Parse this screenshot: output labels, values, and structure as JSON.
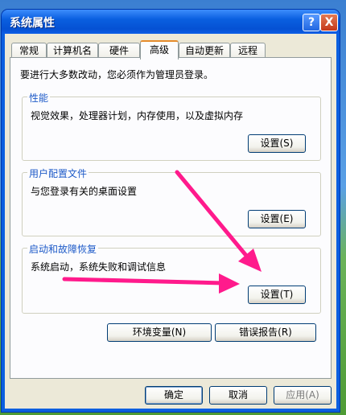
{
  "window": {
    "title": "系统属性",
    "help_label": "?",
    "close_label": "X"
  },
  "tabs": [
    {
      "label": "常规"
    },
    {
      "label": "计算机名"
    },
    {
      "label": "硬件"
    },
    {
      "label": "高级",
      "active": true
    },
    {
      "label": "自动更新"
    },
    {
      "label": "远程"
    }
  ],
  "advanced": {
    "admin_note": "要进行大多数改动，您必须作为管理员登录。",
    "performance": {
      "title": "性能",
      "desc": "视觉效果，处理器计划，内存使用，以及虚拟内存",
      "button": "设置(S)"
    },
    "profiles": {
      "title": "用户配置文件",
      "desc": "与您登录有关的桌面设置",
      "button": "设置(E)"
    },
    "startup": {
      "title": "启动和故障恢复",
      "desc": "系统启动，系统失败和调试信息",
      "button": "设置(T)"
    },
    "env_button": "环境变量(N)",
    "error_button": "错误报告(R)"
  },
  "footer": {
    "ok": "确定",
    "cancel": "取消",
    "apply": "应用(A)"
  },
  "annotation_color": "#ff1a8c"
}
